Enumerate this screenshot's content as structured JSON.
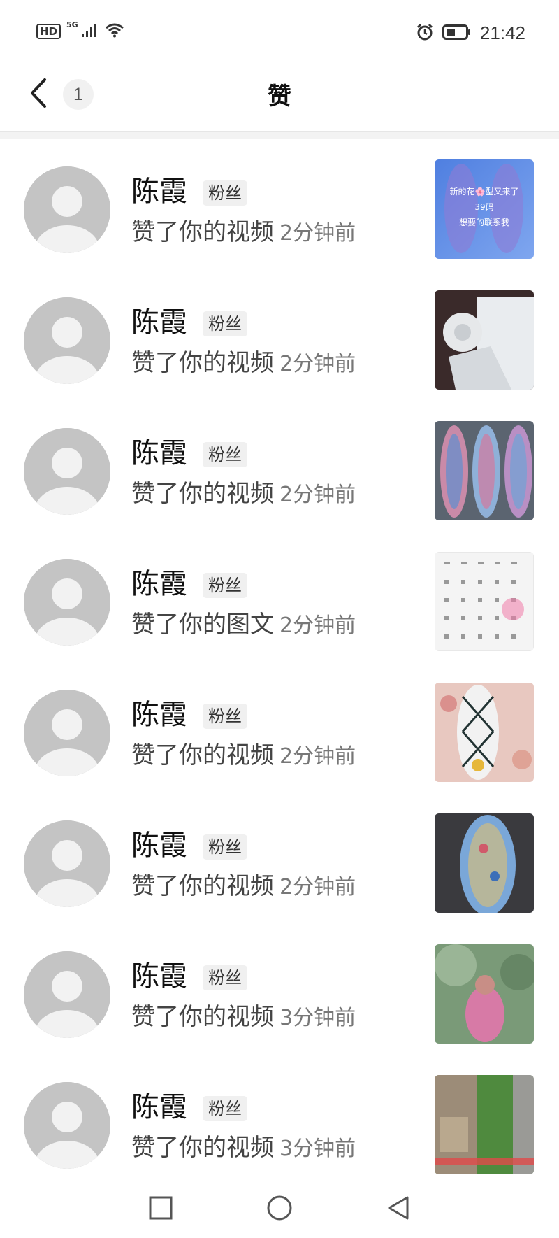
{
  "status_bar": {
    "network_badge": "HD",
    "signal_label": "5G",
    "time": "21:42"
  },
  "header": {
    "back_icon": "chevron-left-icon",
    "count": "1",
    "title": "赞"
  },
  "likes": [
    {
      "name": "陈霞",
      "badge": "粉丝",
      "action": "赞了你的视频",
      "time": "2分钟前",
      "thumb_caption_1": "新的花🌸型又来了",
      "thumb_caption_2": "39码",
      "thumb_caption_3": "想要的联系我"
    },
    {
      "name": "陈霞",
      "badge": "粉丝",
      "action": "赞了你的视频",
      "time": "2分钟前"
    },
    {
      "name": "陈霞",
      "badge": "粉丝",
      "action": "赞了你的视频",
      "time": "2分钟前"
    },
    {
      "name": "陈霞",
      "badge": "粉丝",
      "action": "赞了你的图文",
      "time": "2分钟前"
    },
    {
      "name": "陈霞",
      "badge": "粉丝",
      "action": "赞了你的视频",
      "time": "2分钟前"
    },
    {
      "name": "陈霞",
      "badge": "粉丝",
      "action": "赞了你的视频",
      "time": "2分钟前"
    },
    {
      "name": "陈霞",
      "badge": "粉丝",
      "action": "赞了你的视频",
      "time": "3分钟前"
    },
    {
      "name": "陈霞",
      "badge": "粉丝",
      "action": "赞了你的视频",
      "time": "3分钟前"
    }
  ],
  "nav_bar": {
    "recent_icon": "square-icon",
    "home_icon": "circle-icon",
    "back_icon": "triangle-back-icon"
  },
  "colors": {
    "avatar_bg": "#c4c4c4",
    "badge_bg": "#f0f0f0",
    "divider": "#f3f3f3"
  }
}
